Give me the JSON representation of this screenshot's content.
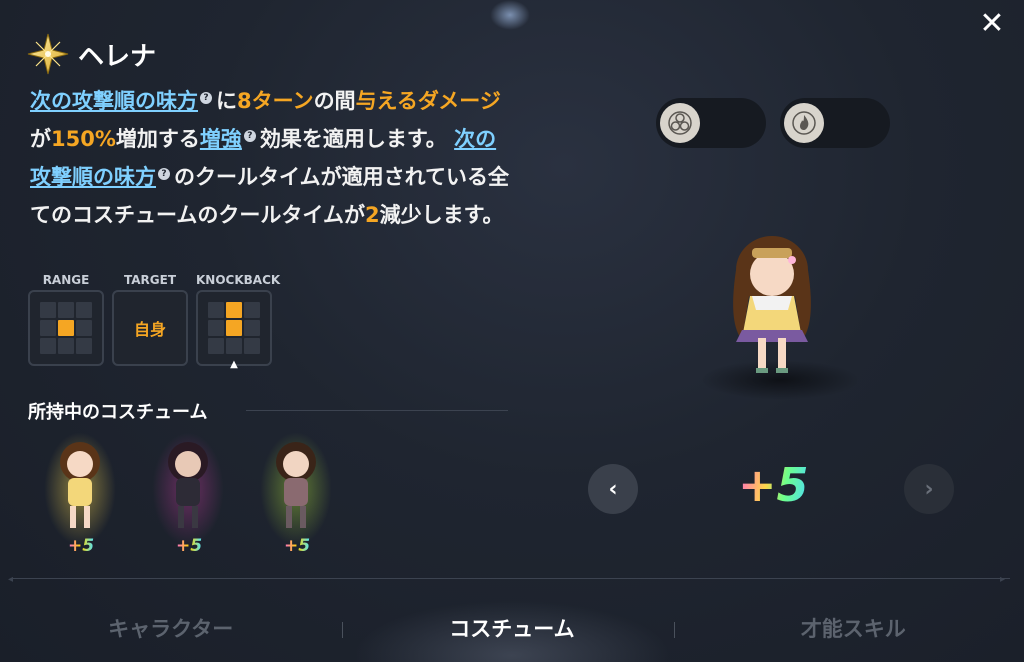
{
  "skill": {
    "name": "ヘレナ",
    "icon": "sparkle-star-icon"
  },
  "description": {
    "seg1_link": "次の攻撃順の味方",
    "seg2": "に",
    "seg3_hl": "8ターン",
    "seg4": "の間",
    "seg5_hl": "与えるダメージ",
    "seg6": "が",
    "seg7_hl": "150%",
    "seg8": "増加する",
    "seg9_link": "増強",
    "seg10": "効果を適用します。",
    "seg11_link": "次の攻撃順の味方",
    "seg12": "のクールタイムが適用されている全てのコスチュームのクールタイムが",
    "seg13_hl": "2",
    "seg14": "減少します。",
    "help_mark": "?"
  },
  "stats": {
    "range_label": "RANGE",
    "target_label": "TARGET",
    "target_value": "自身",
    "knockback_label": "KNOCKBACK",
    "range_grid": [
      0,
      0,
      0,
      0,
      1,
      0,
      0,
      0,
      0
    ],
    "knockback_grid": [
      0,
      1,
      0,
      0,
      1,
      0,
      0,
      0,
      0
    ]
  },
  "owned": {
    "title": "所持中のコスチューム",
    "costumes": [
      {
        "plus": "+5",
        "aura": "gold"
      },
      {
        "plus": "+5",
        "aura": "magenta"
      },
      {
        "plus": "+5",
        "aura": "lime"
      }
    ]
  },
  "elements": [
    {
      "icon": "triple-circle-icon"
    },
    {
      "icon": "flame-icon"
    }
  ],
  "preview": {
    "plus": "+5"
  },
  "tabs": [
    {
      "label": "キャラクター",
      "active": false
    },
    {
      "label": "コスチューム",
      "active": true
    },
    {
      "label": "才能スキル",
      "active": false
    }
  ],
  "colors": {
    "highlight": "#f5a623",
    "link": "#7fd0ff",
    "background": "#1f2530"
  }
}
